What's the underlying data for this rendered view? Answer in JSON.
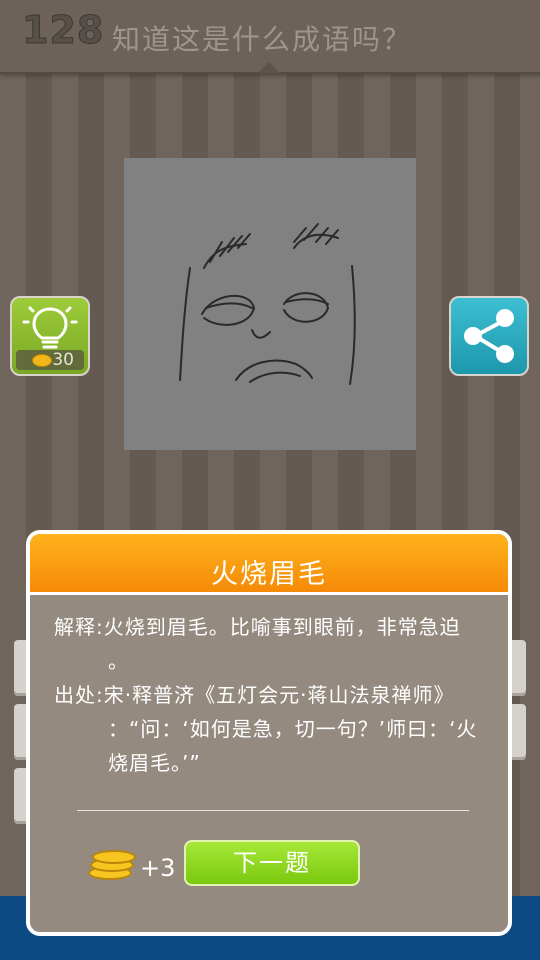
{
  "header": {
    "level": "128",
    "question": "知道这是什么成语吗？"
  },
  "hint": {
    "cost": "30",
    "icon": "lightbulb-icon"
  },
  "share": {
    "icon": "share-icon"
  },
  "dialog": {
    "title": "火烧眉毛",
    "explanation_line1": "解释:火烧到眉毛。比喻事到眼前，非常急迫",
    "explanation_line2": "。",
    "source_line1": "出处:宋·释普济《五灯会元·蒋山法泉禅师》",
    "source_line2": "：“问：‘如何是急，切一句？’师曰：‘火",
    "source_line3": "烧眉毛。’”",
    "reward": "+3",
    "next_button": "下一题"
  },
  "colors": {
    "header_orange": "#f58a07",
    "next_green": "#79c80f",
    "hint_green": "#7aa825",
    "share_blue": "#1d97ab"
  }
}
